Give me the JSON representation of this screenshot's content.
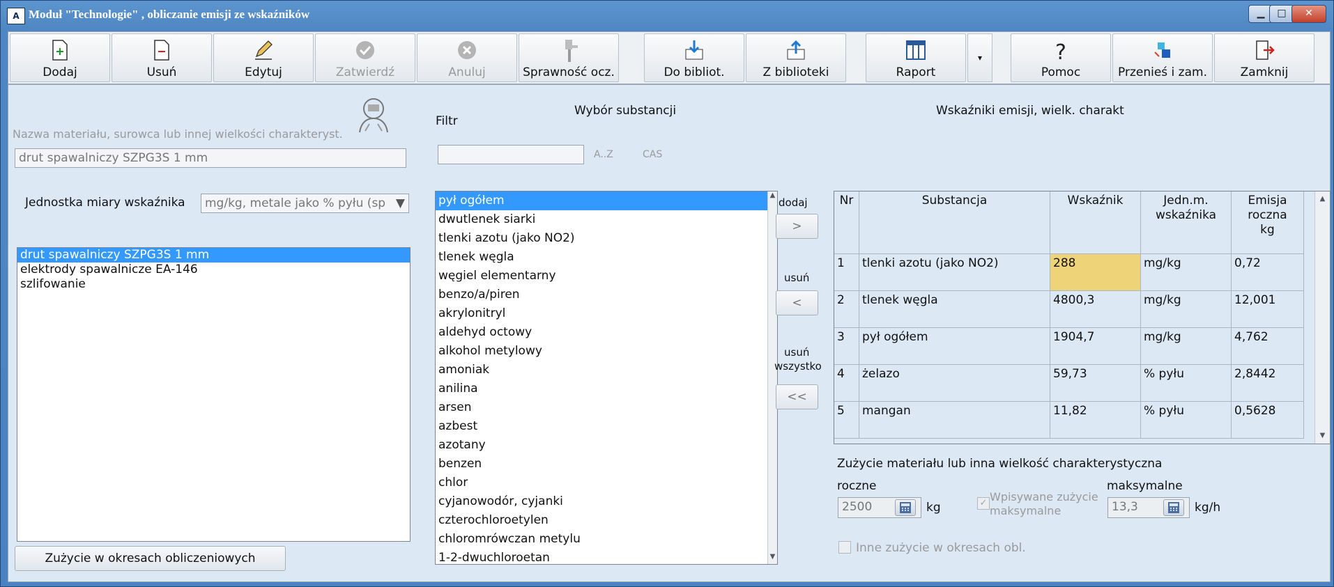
{
  "window": {
    "title": "Moduł  \"Technologie\" , obliczanie emisji ze wskaźników",
    "icon_text": "A"
  },
  "toolbar": {
    "buttons": [
      {
        "label": "Dodaj",
        "icon": "document-plus-icon",
        "enabled": true
      },
      {
        "label": "Usuń",
        "icon": "document-minus-icon",
        "enabled": true
      },
      {
        "label": "Edytuj",
        "icon": "pencil-icon",
        "enabled": true
      },
      {
        "label": "Zatwierdź",
        "icon": "checkmark-icon",
        "enabled": false
      },
      {
        "label": "Anuluj",
        "icon": "cancel-icon",
        "enabled": false
      },
      {
        "label": "Sprawność ocz.",
        "icon": "filter-device-icon",
        "enabled": true
      },
      {
        "label": "Do bibliot.",
        "icon": "download-to-library-icon",
        "enabled": true
      },
      {
        "label": "Z biblioteki",
        "icon": "upload-from-library-icon",
        "enabled": true
      },
      {
        "label": "Raport",
        "icon": "report-table-icon",
        "enabled": true
      },
      {
        "label": "Pomoc",
        "icon": "question-icon",
        "enabled": true
      },
      {
        "label": "Przenieś i zam.",
        "icon": "move-icon",
        "enabled": true
      },
      {
        "label": "Zamknij",
        "icon": "exit-icon",
        "enabled": true
      }
    ]
  },
  "left": {
    "name_label": "Nazwa materiału, surowca lub innej wielkości charakteryst.",
    "name_value": "drut spawalniczy  SZPG3S 1 mm",
    "unit_label": "Jednostka miary wskaźnika",
    "unit_value": "mg/kg,  metale jako % pyłu (sp",
    "materials": [
      "drut spawalniczy  SZPG3S 1 mm",
      "elektrody spawalnicze EA-146",
      "szlifowanie"
    ],
    "periods_button": "Zużycie w okresach obliczeniowych"
  },
  "substances": {
    "title": "Wybór substancji",
    "filter_label": "Filtr",
    "filter_value": "",
    "sort_az": "A..Z",
    "sort_cas": "CAS",
    "items": [
      "pył ogółem",
      "dwutlenek siarki",
      "tlenki azotu (jako NO2)",
      "tlenek węgla",
      "węgiel elementarny",
      "benzo/a/piren",
      "akrylonitryl",
      "aldehyd octowy",
      "alkohol metylowy",
      "amoniak",
      "anilina",
      "arsen",
      "azbest",
      "azotany",
      "benzen",
      "chlor",
      "cyjanowodór, cyjanki",
      "czterochloroetylen",
      "chloromrówczan metylu",
      "1-2-dwuchloroetan"
    ]
  },
  "move_buttons": {
    "add_label": "dodaj",
    "add_symbol": ">",
    "remove_label": "usuń",
    "remove_symbol": "<",
    "remove_all_label_1": "usuń",
    "remove_all_label_2": "wszystko",
    "remove_all_symbol": "<<"
  },
  "emissions": {
    "title": "Wskaźniki  emisji,  wielk. charakt",
    "headers": {
      "nr": "Nr",
      "substance": "Substancja",
      "factor": "Wskaźnik",
      "unit_1": "Jedn.m.",
      "unit_2": "wskaźnika",
      "emission_1": "Emisja",
      "emission_2": "roczna",
      "emission_3": "kg"
    },
    "rows": [
      {
        "nr": "1",
        "substance": "tlenki azotu (jako NO2)",
        "factor": "288",
        "unit": "mg/kg",
        "emission": "0,72"
      },
      {
        "nr": "2",
        "substance": "tlenek węgla",
        "factor": "4800,3",
        "unit": "mg/kg",
        "emission": "12,001"
      },
      {
        "nr": "3",
        "substance": "pył ogółem",
        "factor": "1904,7",
        "unit": "mg/kg",
        "emission": "4,762"
      },
      {
        "nr": "4",
        "substance": "żelazo",
        "factor": "59,73",
        "unit": "% pyłu",
        "emission": "2,8442"
      },
      {
        "nr": "5",
        "substance": "mangan",
        "factor": "11,82",
        "unit": "% pyłu",
        "emission": "0,5628"
      }
    ]
  },
  "usage": {
    "title": "Zużycie materiału lub inna wielkość charakterystyczna",
    "annual_label": "roczne",
    "annual_value": "2500",
    "annual_unit": "kg",
    "entered_max_label_1": "Wpisywane zużycie",
    "entered_max_label_2": "maksymalne",
    "max_label": "maksymalne",
    "max_value": "13,3",
    "max_unit": "kg/h",
    "other_periods_label": "Inne zużycie w okresach obl."
  }
}
